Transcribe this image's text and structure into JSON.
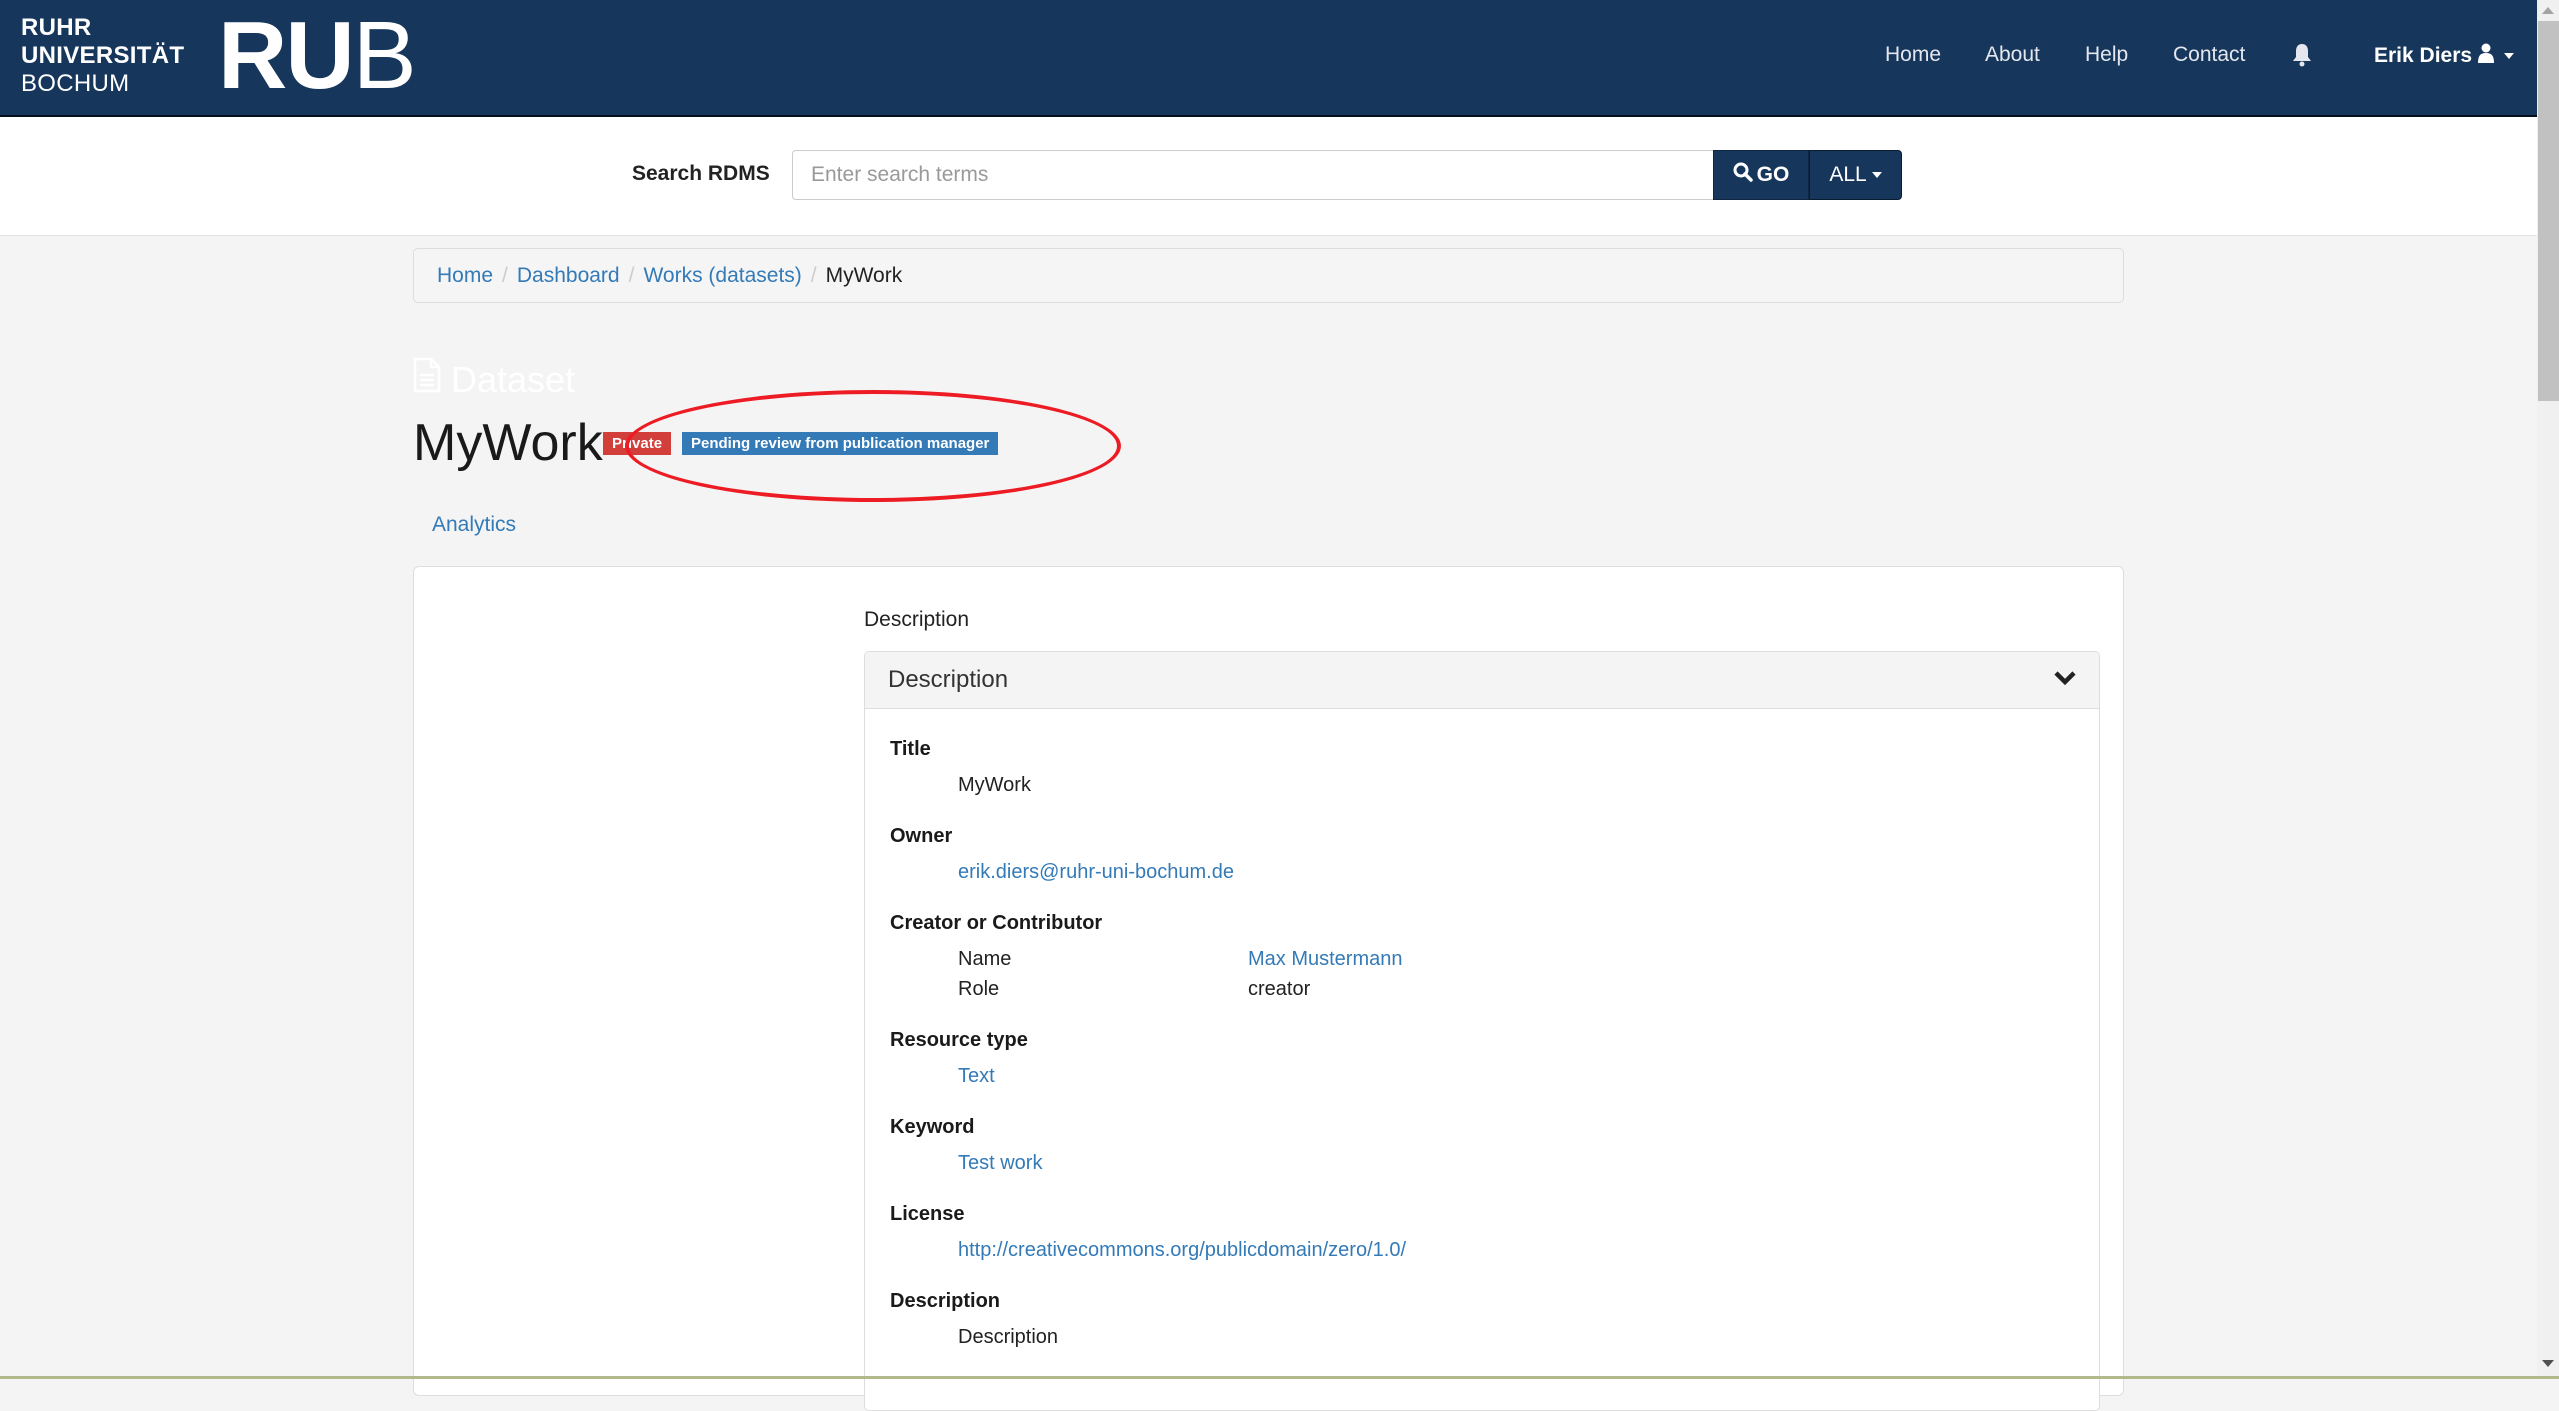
{
  "header": {
    "logo_line1": "RUHR",
    "logo_line2": "UNIVERSITÄT",
    "logo_line3": "BOCHUM",
    "logo_mark_bold": "RU",
    "logo_mark_light": "B",
    "nav": {
      "home": "Home",
      "about": "About",
      "help": "Help",
      "contact": "Contact",
      "notifications_icon": "bell-icon",
      "user_name": "Erik Diers",
      "user_icon": "user-icon"
    },
    "brand_color": "#16365c"
  },
  "search": {
    "label": "Search RDMS",
    "placeholder": "Enter search terms",
    "value": "",
    "go_label": "GO",
    "scope_label": "ALL"
  },
  "breadcrumb": {
    "items": [
      "Home",
      "Dashboard",
      "Works (datasets)"
    ],
    "active": "MyWork"
  },
  "page": {
    "type_label": "Dataset",
    "title": "MyWork",
    "badges": {
      "visibility": "Private",
      "workflow_status": "Pending review from publication manager"
    },
    "badge_colors": {
      "private": "#d23f3a",
      "pending": "#337ab7"
    },
    "tabs": {
      "analytics": "Analytics"
    }
  },
  "metadata": {
    "section_label": "Description",
    "panel_title": "Description",
    "fields": {
      "title": {
        "label": "Title",
        "value": "MyWork"
      },
      "owner": {
        "label": "Owner",
        "value": "erik.diers@ruhr-uni-bochum.de"
      },
      "creator": {
        "label": "Creator or Contributor",
        "name_key": "Name",
        "name_value": "Max Mustermann",
        "role_key": "Role",
        "role_value": "creator"
      },
      "resource_type": {
        "label": "Resource type",
        "value": "Text"
      },
      "keyword": {
        "label": "Keyword",
        "value": "Test work"
      },
      "license": {
        "label": "License",
        "value": "http://creativecommons.org/publicdomain/zero/1.0/"
      },
      "description": {
        "label": "Description",
        "value": "Description"
      }
    }
  }
}
